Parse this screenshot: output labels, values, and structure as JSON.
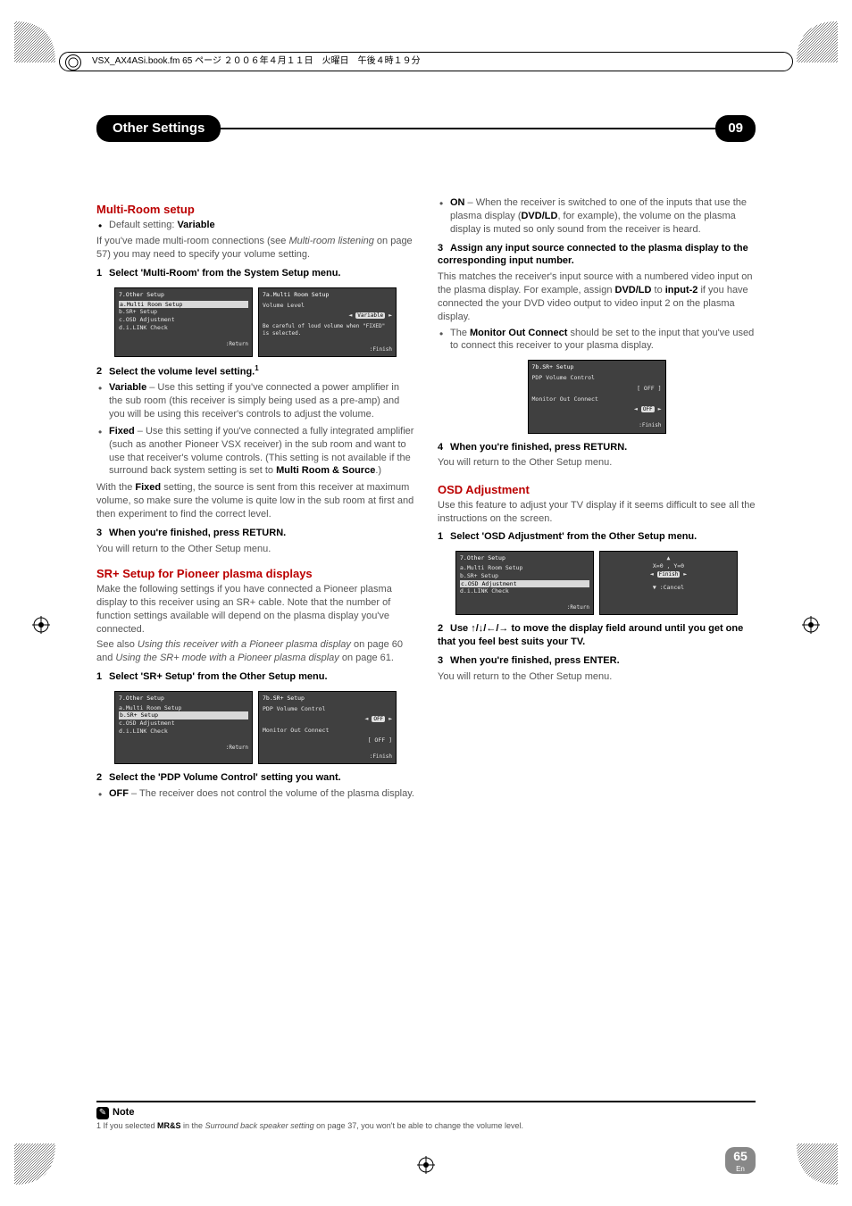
{
  "booktag": "VSX_AX4ASi.book.fm 65 ページ ２００６年４月１１日　火曜日　午後４時１９分",
  "header": {
    "title": "Other Settings",
    "chapter": "09"
  },
  "left": {
    "h_multi": "Multi-Room setup",
    "default": "Default setting:",
    "default_val": "Variable",
    "intro1": "If you've made multi-room connections (see ",
    "intro_ital": "Multi-room listening",
    "intro2": " on page 57) you may need to specify your volume setting.",
    "step1": "Select 'Multi-Room' from the System Setup menu.",
    "osd1": {
      "title": "7.Other Setup",
      "items": [
        "a.Multi Room Setup",
        "b.SR+ Setup",
        "c.OSD Adjustment",
        "d.i.LINK Check"
      ],
      "ret": ":Return"
    },
    "osd2": {
      "title": "7a.Multi Room Setup",
      "vl": "Volume Level",
      "val": "Variable",
      "warn": "Be careful of loud volume when \"FIXED\" is selected.",
      "ret": ":Finish"
    },
    "step2": "Select the volume level setting.",
    "bul_var_t": "Variable",
    "bul_var": " – Use this setting if you've connected a power amplifier in the sub room (this receiver is simply being used as a pre-amp) and you will be using this receiver's controls to adjust the volume.",
    "bul_fix_t": "Fixed",
    "bul_fix": " – Use this setting if you've connected a fully integrated amplifier (such as another Pioneer VSX receiver) in the sub room and want to use that receiver's volume controls. (This setting is not available if the surround back system setting is set to ",
    "bul_fix2": "Multi Room & Source",
    "bul_fix3": ".)",
    "fixed_p1a": "With the ",
    "fixed_p1b": "Fixed",
    "fixed_p1c": " setting, the source is sent from this receiver at maximum volume, so make sure the volume is quite low in the sub room at first and then experiment to find the correct level.",
    "step3": "When you're finished, press RETURN.",
    "ret_txt": "You will return to the Other Setup menu.",
    "h_sr": "SR+ Setup for Pioneer plasma displays",
    "sr_p1": "Make the following settings if you have connected a Pioneer plasma display to this receiver using an SR+ cable. Note that the number of function settings available will depend on the plasma display you've connected.",
    "sr_p2a": "See also ",
    "sr_p2b": "Using this receiver with a Pioneer plasma display",
    "sr_p2c": " on page 60 and ",
    "sr_p2d": "Using the SR+ mode with a Pioneer plasma display",
    "sr_p2e": " on page 61.",
    "sr_step1": "Select 'SR+ Setup' from the Other Setup menu.",
    "osd3": {
      "title": "7.Other Setup",
      "items": [
        "a.Multi Room Setup",
        "b.SR+ Setup",
        "c.OSD Adjustment",
        "d.i.LINK Check"
      ],
      "ret": ":Return"
    },
    "osd4": {
      "title": "7b.SR+ Setup",
      "l1": "PDP Volume Control",
      "v1": "OFF",
      "l2": "Monitor Out Connect",
      "v2": "OFF",
      "ret": ":Finish"
    },
    "sr_step2": "Select the 'PDP Volume Control' setting you want.",
    "bul_off_t": "OFF",
    "bul_off": " – The receiver does not control the volume of the plasma display."
  },
  "right": {
    "bul_on_t": "ON",
    "bul_on": " – When the receiver is switched to one of the inputs that use the plasma display (",
    "bul_on_b": "DVD/LD",
    "bul_on2": ", for example), the volume on the plasma display is muted so only sound from the receiver is heard.",
    "step3": "Assign any input source connected to the plasma display to the corresponding input number.",
    "p3a": "This matches the receiver's input source with a numbered video input on the plasma display. For example, assign ",
    "p3b": "DVD/LD",
    "p3c": " to ",
    "p3d": "input-2",
    "p3e": " if you have connected the your DVD video output to video input 2 on the plasma display.",
    "bul_mon_a": "The ",
    "bul_mon_b": "Monitor Out Connect",
    "bul_mon_c": " should be set to the input that you've used to connect this receiver to your plasma display.",
    "osd5": {
      "title": "7b.SR+ Setup",
      "l1": "PDP Volume Control",
      "v1": "OFF",
      "l2": "Monitor Out Connect",
      "v2": "OFF",
      "ret": ":Finish"
    },
    "step4": "When you're finished, press RETURN.",
    "ret_txt": "You will return to the Other Setup menu.",
    "h_osd": "OSD Adjustment",
    "osd_p": "Use this feature to adjust your TV display if it seems difficult to see all the instructions on the screen.",
    "osd_step1": "Select 'OSD Adjustment' from the Other Setup menu.",
    "osd6": {
      "title": "7.Other Setup",
      "items": [
        "a.Multi Room Setup",
        "b.SR+ Setup",
        "c.OSD Adjustment",
        "d.i.LINK Check"
      ],
      "ret": ":Return"
    },
    "osd7": {
      "xy": "X=0 , Y=0",
      "fin": "Finish",
      "can": ":Cancel"
    },
    "osd_step2a": "Use ",
    "osd_step2b": " to move the display field around until you get one that you feel best suits your TV.",
    "osd_step3": "When you're finished, press ENTER.",
    "osd_ret": "You will return to the Other Setup menu."
  },
  "footnote": {
    "label": "Note",
    "text1": "1 If you selected ",
    "text_b": "MR&S",
    "text2": " in the ",
    "text_i": "Surround back speaker setting",
    "text3": " on page 37, you won't be able to change the volume level."
  },
  "page": {
    "num": "65",
    "lang": "En"
  }
}
